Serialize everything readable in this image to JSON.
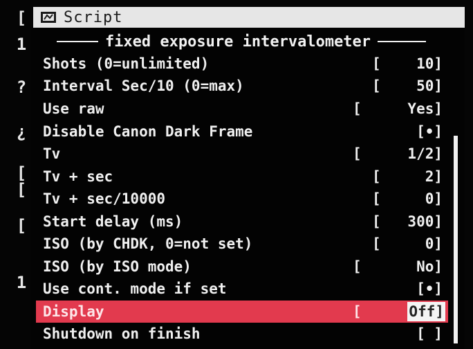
{
  "window": {
    "title": "Script"
  },
  "edge": [
    "[",
    "1",
    "?",
    "¿",
    "[",
    "[",
    "[",
    "1"
  ],
  "heading": "fixed exposure intervalometer",
  "items": [
    {
      "label": "Shots (0=unlimited)",
      "bracket": "[",
      "value": "10]"
    },
    {
      "label": "Interval Sec/10 (0=max)",
      "bracket": "[",
      "value": "50]"
    },
    {
      "label": "Use raw",
      "bracket": "[",
      "value": "Yes]"
    },
    {
      "label": "Disable Canon Dark Frame",
      "bracket": "",
      "value": "[•]"
    },
    {
      "label": "Tv",
      "bracket": "[",
      "value": "1/2]"
    },
    {
      "label": "Tv + sec",
      "bracket": "[",
      "value": "2]"
    },
    {
      "label": "Tv + sec/10000",
      "bracket": "[",
      "value": "0]"
    },
    {
      "label": "Start delay (ms)",
      "bracket": "[",
      "value": "300]"
    },
    {
      "label": "ISO (by CHDK, 0=not set)",
      "bracket": "[",
      "value": "0]"
    },
    {
      "label": "ISO (by ISO mode)",
      "bracket": "[",
      "value": "No]"
    },
    {
      "label": "Use cont. mode if set",
      "bracket": "",
      "value": "[•]"
    },
    {
      "label": "Display",
      "bracket": "[",
      "value": "Off]",
      "selected": true
    },
    {
      "label": "Shutdown on finish",
      "bracket": "",
      "value": "[ ]"
    }
  ],
  "colors": {
    "selected_row": "#e23a4e",
    "title_bar": "#e6e6e6"
  }
}
